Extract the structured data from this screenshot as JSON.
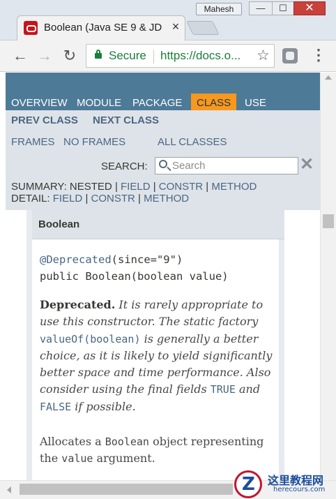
{
  "browser": {
    "profile_name": "Mahesh",
    "window_controls": {
      "minimize": "—",
      "maximize": "☐",
      "close": "✕"
    },
    "tab": {
      "title": "Boolean (Java SE 9 & JDK",
      "close": "×",
      "favicon": "oracle-icon"
    },
    "toolbar": {
      "back": "←",
      "forward": "→",
      "reload": "↻",
      "security_label": "Secure",
      "url": "https://docs.o...",
      "bookmark": "☆",
      "menu": "⋮"
    }
  },
  "javadoc": {
    "topnav": {
      "items": [
        "OVERVIEW",
        "MODULE",
        "PACKAGE",
        "CLASS",
        "USE"
      ],
      "active": "CLASS",
      "active_color": "#f8981d",
      "bar_color": "#4d7a97"
    },
    "subnav": {
      "prev": "PREV CLASS",
      "next": "NEXT CLASS",
      "frames": "FRAMES",
      "no_frames": "NO FRAMES",
      "all_classes": "ALL CLASSES",
      "search_label": "SEARCH:",
      "search_placeholder": "Search",
      "search_reset": "✕",
      "summary_label": "SUMMARY:",
      "summary_nested": "NESTED",
      "summary_field": "FIELD",
      "summary_constr": "CONSTR",
      "summary_method": "METHOD",
      "detail_label": "DETAIL:",
      "detail_field": "FIELD",
      "detail_constr": "CONSTR",
      "detail_method": "METHOD",
      "sep": "|"
    },
    "member": {
      "title": "Boolean",
      "annotation": "@Deprecated",
      "annotation_args": "(since=\"9\")",
      "signature": "public Boolean(boolean value)",
      "deprecated_label": "Deprecated.",
      "dep_text_1": "It is rarely appropriate to use this constructor. The static factory",
      "dep_code_1": "valueOf(boolean)",
      "dep_text_2": "is generally a better choice, as it is likely to yield significantly better space and time performance. Also consider using the final fields",
      "dep_code_2": "TRUE",
      "dep_text_3": "and",
      "dep_code_3": "FALSE",
      "dep_text_4": "if possible.",
      "desc_1": "Allocates a",
      "desc_code_1": "Boolean",
      "desc_2": "object representing the",
      "desc_code_2": "value",
      "desc_3": "argument."
    }
  },
  "watermark": {
    "name_cn": "这里教程网",
    "name_en": "herecours.com"
  }
}
